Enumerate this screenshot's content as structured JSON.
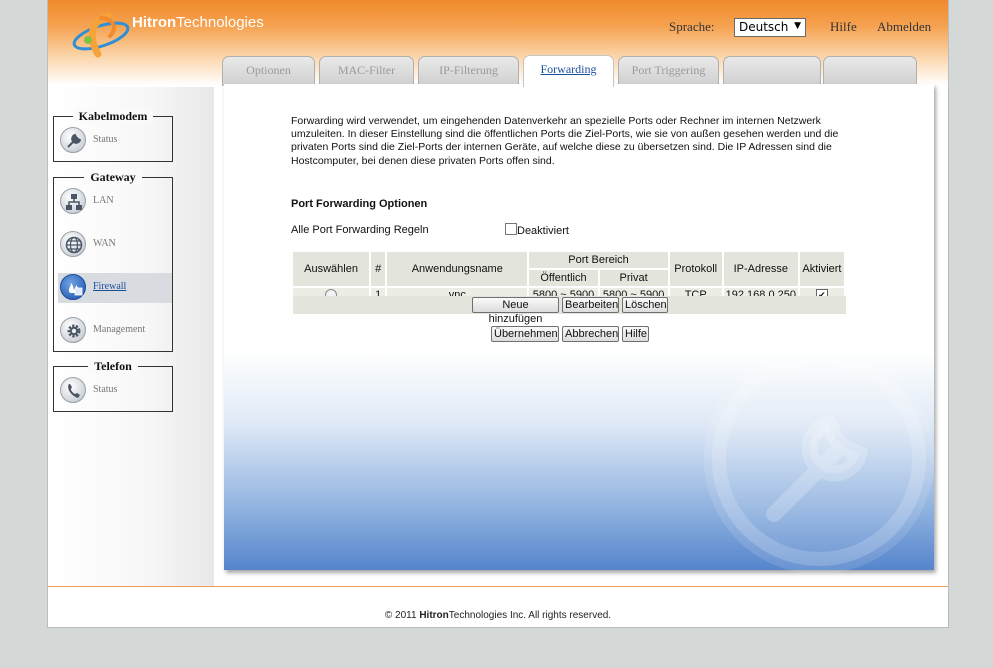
{
  "brand": {
    "logo_bold": "Hitron",
    "logo_light": "Technologies"
  },
  "header": {
    "language_label": "Sprache:",
    "language_value": "Deutsch",
    "help": "Hilfe",
    "logout": "Abmelden"
  },
  "tabs": [
    {
      "label": "Optionen"
    },
    {
      "label": "MAC-Filter"
    },
    {
      "label": "IP-Filterung"
    },
    {
      "label": "Forwarding"
    },
    {
      "label": "Port Triggering"
    },
    {
      "label": ""
    },
    {
      "label": ""
    }
  ],
  "sidebar": {
    "groups": [
      {
        "title": "Kabelmodem",
        "items": [
          {
            "label": "Status",
            "icon": "wrench-icon"
          }
        ]
      },
      {
        "title": "Gateway",
        "items": [
          {
            "label": "LAN",
            "icon": "lan-icon"
          },
          {
            "label": "WAN",
            "icon": "globe-icon"
          },
          {
            "label": "Firewall",
            "icon": "firewall-icon"
          },
          {
            "label": "Management",
            "icon": "gear-icon"
          }
        ]
      },
      {
        "title": "Telefon",
        "items": [
          {
            "label": "Status",
            "icon": "phone-icon"
          }
        ]
      }
    ]
  },
  "main": {
    "intro": "Forwarding wird verwendet, um eingehenden Datenverkehr an spezielle Ports oder Rechner im internen Netzwerk umzuleiten. In dieser Einstellung sind die öffentlichen Ports die Ziel-Ports, wie sie von außen gesehen werden und die privaten Ports sind die Ziel-Ports der internen Geräte, auf welche diese zu übersetzen sind. Die IP Adressen sind die Hostcomputer, bei denen diese privaten Ports offen sind.",
    "section_title": "Port Forwarding Optionen",
    "all_rules_label": "Alle Port Forwarding Regeln",
    "disabled_label": "Deaktiviert",
    "table": {
      "headers": {
        "select": "Auswählen",
        "num": "#",
        "app_name": "Anwendungsname",
        "port_range": "Port Bereich",
        "public": "Öffentlich",
        "private": "Privat",
        "protocol": "Protokoll",
        "ip": "IP-Adresse",
        "enabled": "Aktiviert"
      },
      "rows": [
        {
          "num": "1",
          "app_name": "vnc",
          "public": "5800 ~ 5900",
          "private": "5800 ~ 5900",
          "protocol": "TCP",
          "ip": "192.168.0.250"
        }
      ]
    },
    "buttons": {
      "add": "Neue hinzufügen",
      "edit": "Bearbeiten",
      "delete": "Löschen",
      "apply": "Übernehmen",
      "cancel": "Abbrechen",
      "help": "Hilfe"
    }
  },
  "footer": {
    "copyright_prefix": "© 2011",
    "brand_bold": "Hitron",
    "brand_light": "Technologies",
    "copyright_suffix": "Inc.  All rights reserved."
  },
  "colors": {
    "accent_orange": "#f08a2c",
    "link_blue": "#1a4f9c",
    "content_blue": "#5585cc"
  }
}
